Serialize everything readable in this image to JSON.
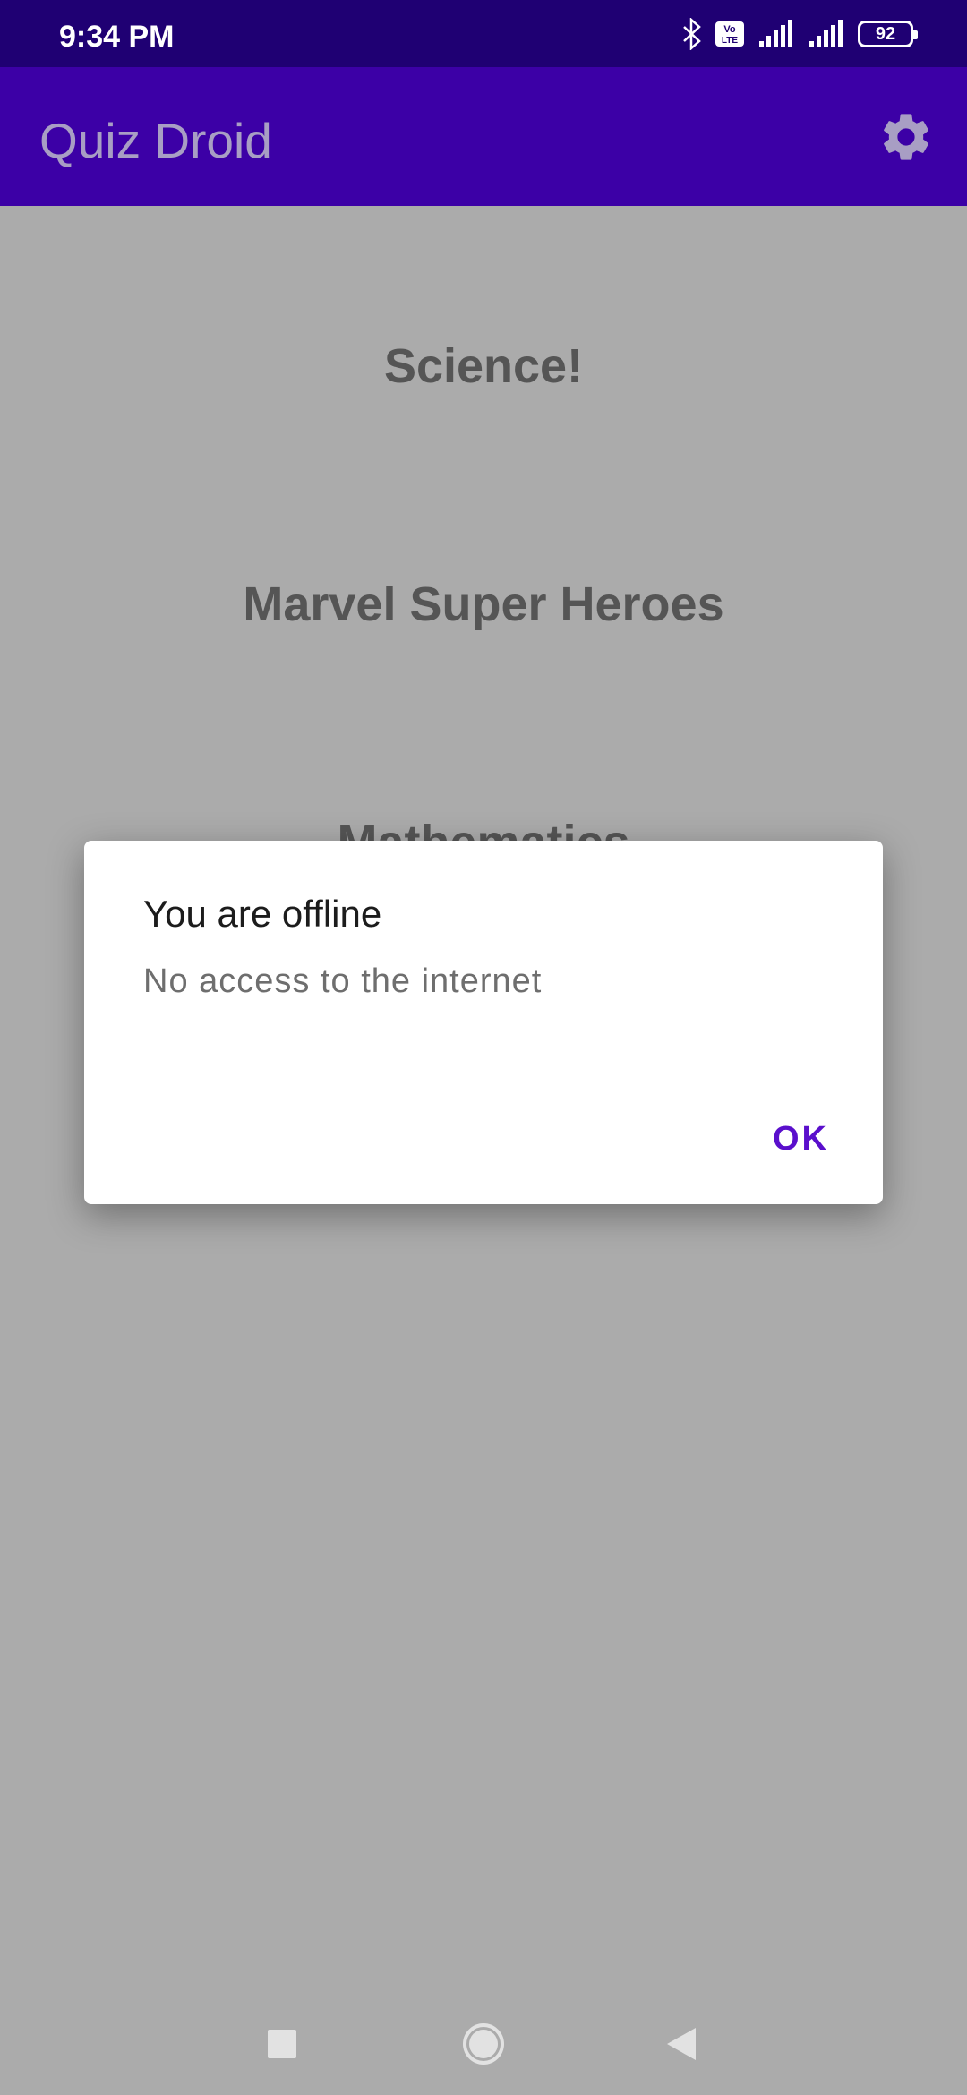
{
  "status_bar": {
    "time": "9:34 PM",
    "volte_label": "Vo LTE",
    "battery": "92",
    "icons": [
      "bluetooth-icon",
      "volte-icon",
      "signal-icon",
      "signal-icon",
      "battery-icon"
    ]
  },
  "app_bar": {
    "title": "Quiz Droid",
    "settings_icon": "gear-icon"
  },
  "categories": [
    "Science!",
    "Marvel Super Heroes",
    "Mathematics"
  ],
  "dialog": {
    "title": "You are offline",
    "message": "No access to the internet",
    "ok_label": "OK"
  },
  "nav_bar": {
    "icons": [
      "recents-square-icon",
      "home-circle-icon",
      "back-triangle-icon"
    ]
  },
  "colors": {
    "status_bar": "#1f0073",
    "app_bar": "#3c00a6",
    "scrim_background": "#ababab",
    "accent": "#5a0fcc"
  }
}
